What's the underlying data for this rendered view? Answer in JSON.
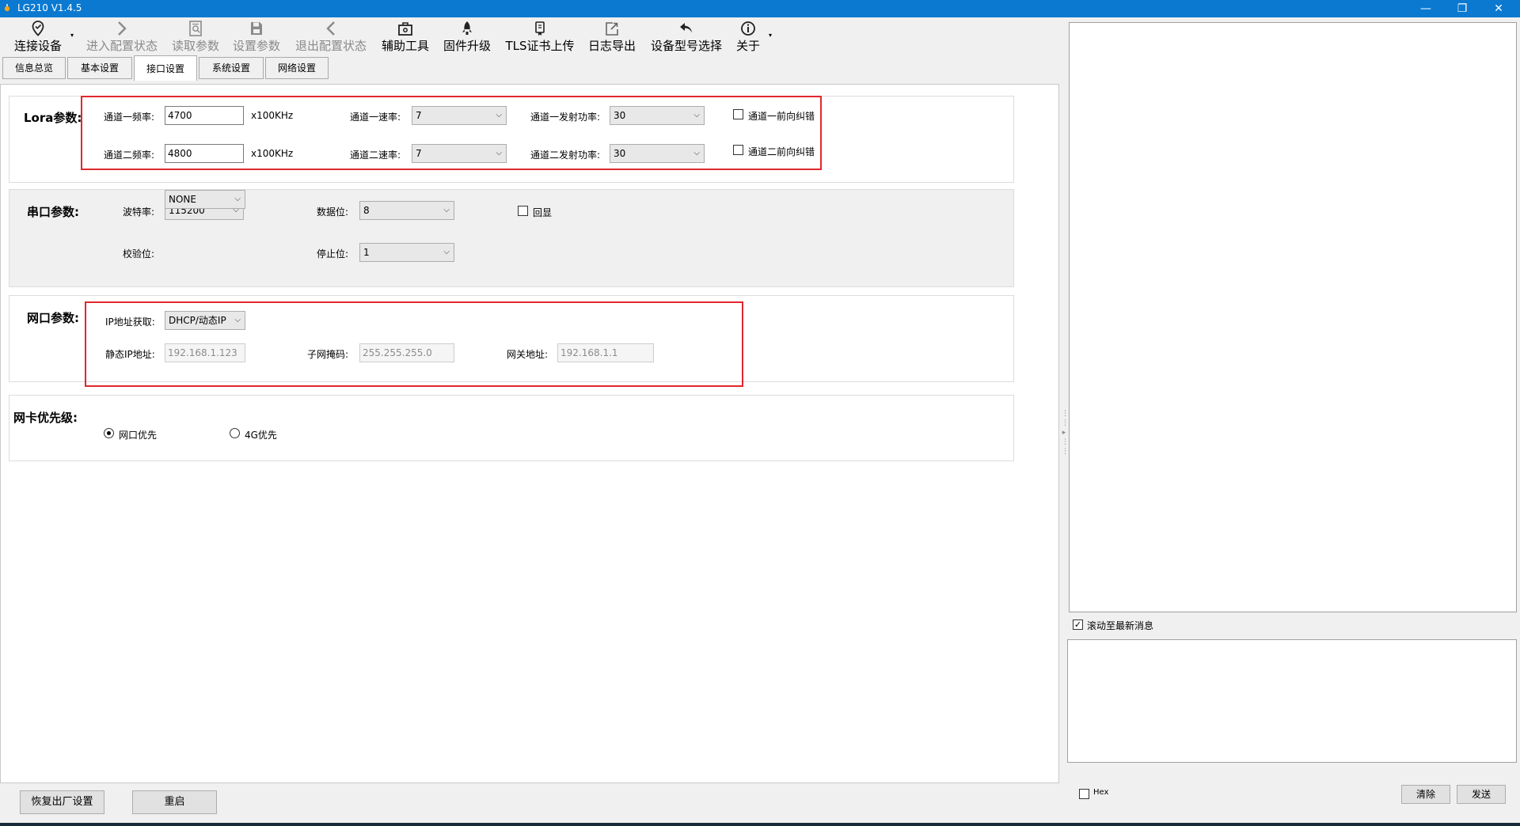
{
  "window": {
    "title": "LG210 V1.4.5",
    "minimize_glyph": "—",
    "restore_glyph": "❐",
    "close_glyph": "✕"
  },
  "toolbar": {
    "connect": {
      "label": "连接设备",
      "icon": "map-pin-icon"
    },
    "enter_config": {
      "label": "进入配置状态",
      "icon": "chevron-right-icon"
    },
    "read_params": {
      "label": "读取参数",
      "icon": "read-document-icon"
    },
    "set_params": {
      "label": "设置参数",
      "icon": "save-icon"
    },
    "exit_config": {
      "label": "退出配置状态",
      "icon": "chevron-left-icon"
    },
    "tools": {
      "label": "辅助工具",
      "icon": "toolbox-icon"
    },
    "firmware": {
      "label": "固件升级",
      "icon": "rocket-icon"
    },
    "tls": {
      "label": "TLS证书上传",
      "icon": "certificate-icon"
    },
    "log_export": {
      "label": "日志导出",
      "icon": "export-icon"
    },
    "device_model": {
      "label": "设备型号选择",
      "icon": "undo-arrow-icon"
    },
    "about": {
      "label": "关于",
      "icon": "info-icon"
    },
    "dropdown_glyph": "▾"
  },
  "tabs": [
    {
      "label": "信息总览"
    },
    {
      "label": "基本设置"
    },
    {
      "label": "接口设置",
      "active": true
    },
    {
      "label": "系统设置"
    },
    {
      "label": "网络设置"
    }
  ],
  "lora": {
    "title": "Lora参数:",
    "ch1_freq_label": "通道一频率:",
    "ch1_freq": "4700",
    "ch2_freq_label": "通道二频率:",
    "ch2_freq": "4800",
    "freq_unit": "x100KHz",
    "ch1_rate_label": "通道一速率:",
    "ch1_rate": "7",
    "ch2_rate_label": "通道二速率:",
    "ch2_rate": "7",
    "ch1_power_label": "通道一发射功率:",
    "ch1_power": "30",
    "ch2_power_label": "通道二发射功率:",
    "ch2_power": "30",
    "ch1_fec_label": "通道一前向纠错",
    "ch2_fec_label": "通道二前向纠错"
  },
  "serial": {
    "title": "串口参数:",
    "baud_label": "波特率:",
    "baud": "115200",
    "databits_label": "数据位:",
    "databits": "8",
    "echo_label": "回显",
    "parity_label": "校验位:",
    "parity": "NONE",
    "stopbits_label": "停止位:",
    "stopbits": "1"
  },
  "net": {
    "title": "网口参数:",
    "ip_mode_label": "IP地址获取:",
    "ip_mode": "DHCP/动态IP",
    "static_ip_label": "静态IP地址:",
    "static_ip": "192.168.1.123",
    "mask_label": "子网掩码:",
    "mask": "255.255.255.0",
    "gateway_label": "网关地址:",
    "gateway": "192.168.1.1"
  },
  "priority": {
    "title": "网卡优先级:",
    "eth_label": "网口优先",
    "g4_label": "4G优先",
    "selected": "eth"
  },
  "bottom": {
    "factory_reset": "恢复出厂设置",
    "reboot": "重启",
    "hex_label": "Hex",
    "clear": "清除",
    "send": "发送"
  },
  "right": {
    "autoscroll_label": "滚动至最新消息"
  },
  "glyphs": {
    "check": "✓",
    "combo_arrow": "⌵",
    "splitter_arrow": "▸"
  },
  "colors": {
    "titlebar": "#0b79d0",
    "highlight": "#e0282d"
  }
}
